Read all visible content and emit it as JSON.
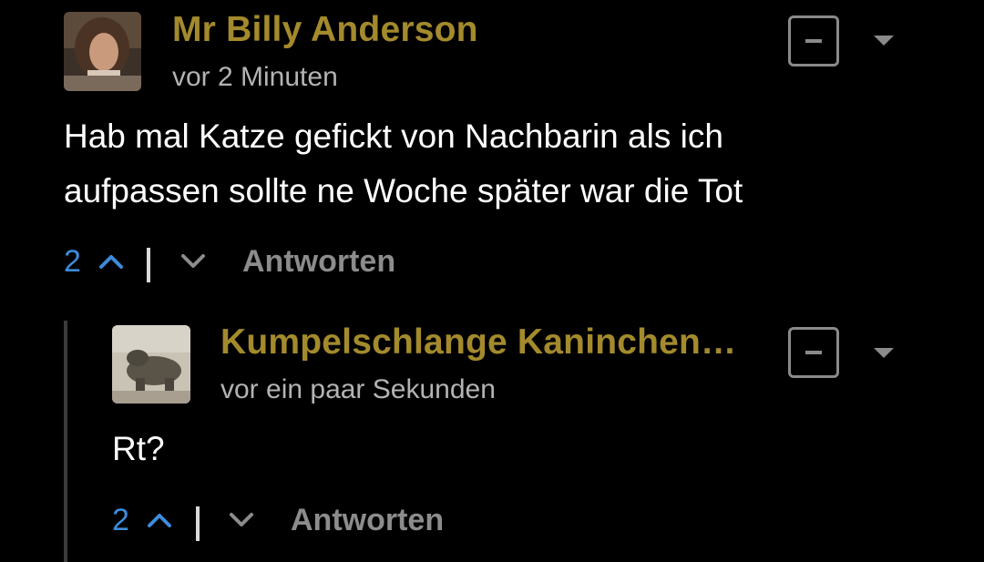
{
  "comments": [
    {
      "author": "Mr Billy Anderson",
      "time": "vor 2 Minuten",
      "body_line1": "Hab mal Katze gefickt von Nachbarin als ich",
      "body_line2": "aufpassen sollte ne Woche später war die Tot",
      "votes": "2",
      "reply_label": "Antworten"
    },
    {
      "author": "Kumpelschlange Kaninchen…",
      "time": "vor ein paar Sekunden",
      "body_line1": "Rt?",
      "votes": "2",
      "reply_label": "Antworten"
    }
  ],
  "colors": {
    "author": "#a38a2c",
    "vote_count": "#3d8bd9",
    "muted": "#8c8c8c",
    "background": "#000000"
  }
}
